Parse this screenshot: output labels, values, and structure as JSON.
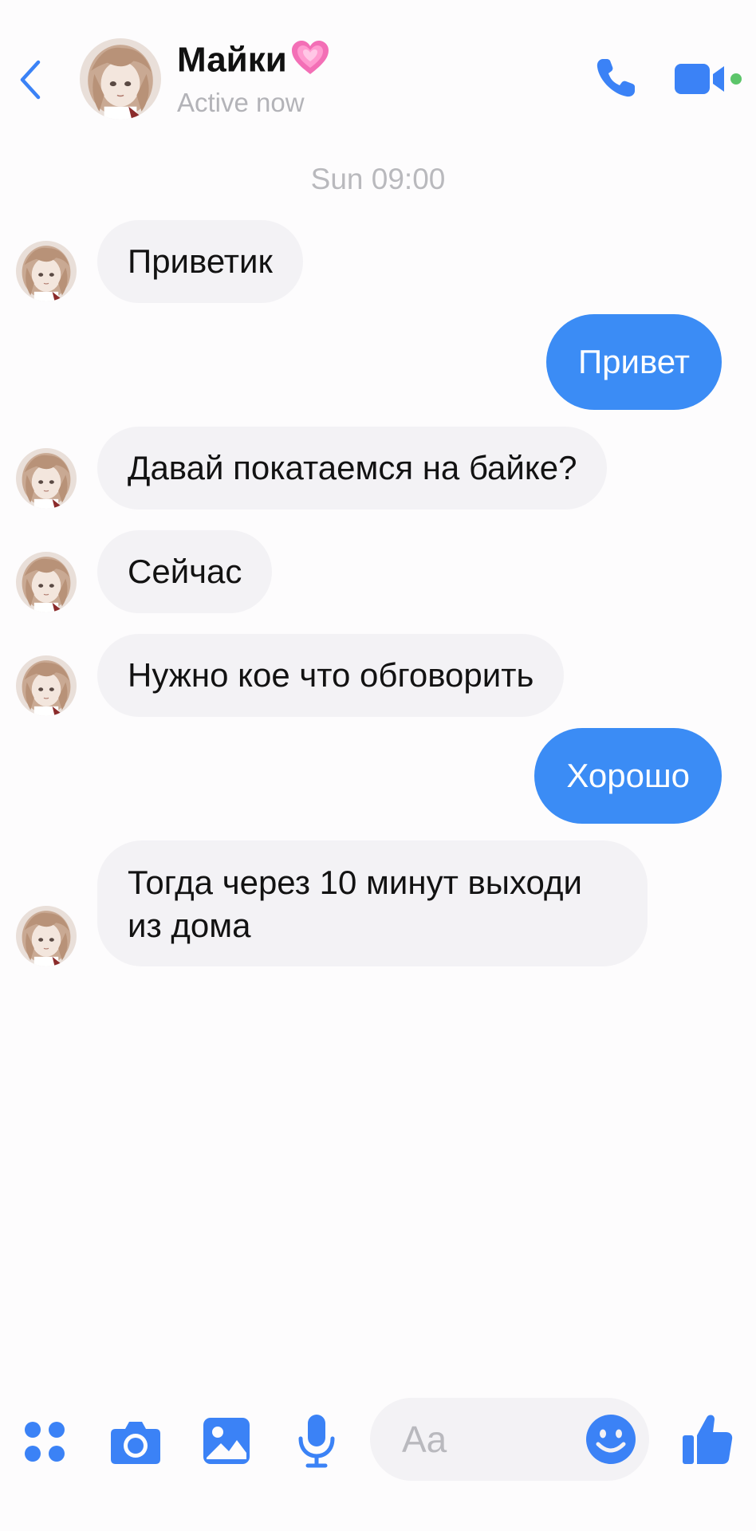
{
  "header": {
    "contact_name": "Майки",
    "status": "Active now",
    "accent_color": "#3b82f6",
    "icons": [
      "back-chevron-icon",
      "pink-heart-emoji",
      "phone-icon",
      "video-camera-icon",
      "online-dot"
    ]
  },
  "conversation": {
    "timestamp": "Sun 09:00",
    "messages": [
      {
        "from": "contact",
        "text": "Приветик"
      },
      {
        "from": "me",
        "text": "Привет"
      },
      {
        "from": "contact",
        "text": "Давай покатаемся на байке?"
      },
      {
        "from": "contact",
        "text": "Сейчас"
      },
      {
        "from": "contact",
        "text": "Нужно кое что обговорить"
      },
      {
        "from": "me",
        "text": "Хорошо"
      },
      {
        "from": "contact",
        "text": "Тогда через 10 минут выходи из дома"
      }
    ]
  },
  "composer": {
    "placeholder": "Aa",
    "value": "",
    "icons": [
      "apps-grid-icon",
      "camera-icon",
      "gallery-icon",
      "microphone-icon",
      "emoji-icon",
      "thumbs-up-icon"
    ]
  },
  "colors": {
    "outgoing_bubble": "#3b8cf5",
    "incoming_bubble": "#f3f2f5",
    "icon_blue": "#3b82f6",
    "online_green": "#5cc56a"
  }
}
